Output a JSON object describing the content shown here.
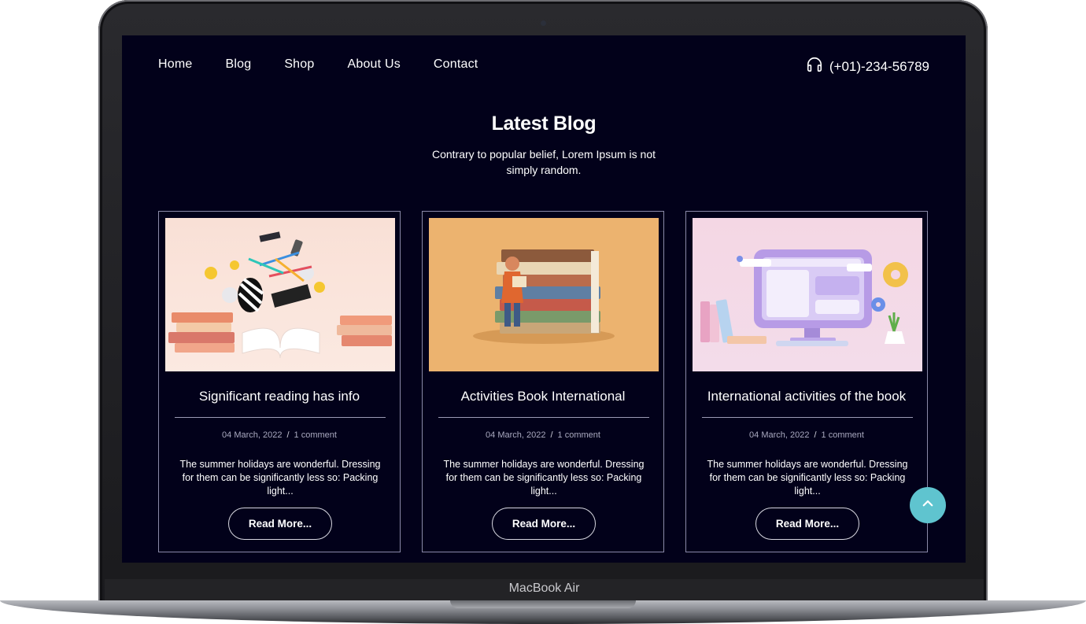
{
  "device": {
    "brand_label": "MacBook Air"
  },
  "nav": {
    "items": [
      {
        "label": "Home"
      },
      {
        "label": "Blog"
      },
      {
        "label": "Shop"
      },
      {
        "label": "About Us"
      },
      {
        "label": "Contact"
      }
    ],
    "phone_icon": "headphones-icon",
    "phone": "(+01)-234-56789"
  },
  "blog": {
    "title": "Latest Blog",
    "subtitle": "Contrary to popular belief, Lorem Ipsum is not simply random.",
    "cards": [
      {
        "image": "books-graduation-illustration",
        "title": "Significant reading has info",
        "date": "04 March, 2022",
        "separator": "/",
        "comments": "1 comment",
        "excerpt": "The summer holidays are wonderful. Dressing for them can be significantly less so: Packing light...",
        "button": "Read More..."
      },
      {
        "image": "girl-on-book-stack-illustration",
        "title": "Activities Book International",
        "date": "04 March, 2022",
        "separator": "/",
        "comments": "1 comment",
        "excerpt": "The summer holidays are wonderful. Dressing for them can be significantly less so: Packing light...",
        "button": "Read More..."
      },
      {
        "image": "computer-desk-illustration",
        "title": "International activities of the book",
        "date": "04 March, 2022",
        "separator": "/",
        "comments": "1 comment",
        "excerpt": "The summer holidays are wonderful. Dressing for them can be significantly less so: Packing light...",
        "button": "Read More..."
      }
    ]
  },
  "scroll_top": {
    "icon": "chevron-up-icon"
  },
  "colors": {
    "screen_bg": "#02011a",
    "accent": "#5fc4cf",
    "card_border": "#8a8aa8"
  }
}
